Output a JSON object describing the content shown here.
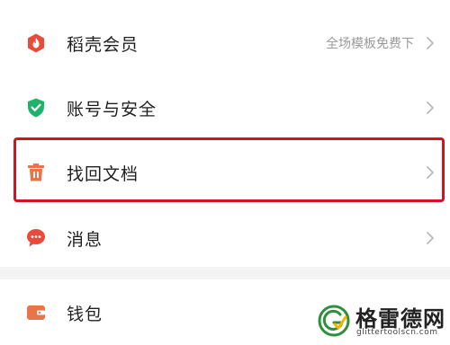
{
  "menu": {
    "items": [
      {
        "label": "稻壳会员",
        "extra": "全场模板免费下",
        "icon": "flame-icon",
        "icon_color": "#e84a3c"
      },
      {
        "label": "账号与安全",
        "extra": "",
        "icon": "shield-check-icon",
        "icon_color": "#20b26b"
      },
      {
        "label": "找回文档",
        "extra": "",
        "icon": "trash-icon",
        "icon_color": "#e8744a"
      },
      {
        "label": "消息",
        "extra": "",
        "icon": "chat-bubble-icon",
        "icon_color": "#e84a3c"
      },
      {
        "label": "钱包",
        "extra": "",
        "icon": "wallet-icon",
        "icon_color": "#e8744a"
      }
    ],
    "highlighted_index": 2,
    "highlight_color": "#d3121d"
  },
  "watermark": {
    "title": "格雷德网",
    "url": "glittertoolscn.com"
  }
}
